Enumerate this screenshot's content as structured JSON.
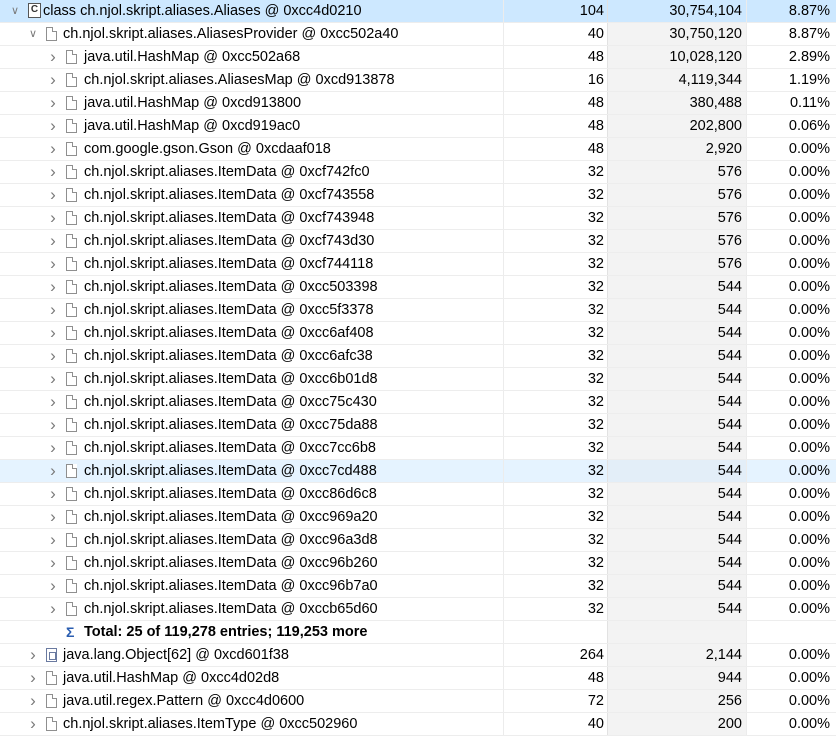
{
  "class_icon_letter": "C",
  "rows": [
    {
      "label": "class ch.njol.skript.aliases.Aliases @ 0xcc4d0210",
      "shallow": "104",
      "retained": "30,754,104",
      "pct": "8.87%",
      "depth": 0,
      "twisty": "open",
      "icon": "class",
      "state": "selected"
    },
    {
      "label": "ch.njol.skript.aliases.AliasesProvider @ 0xcc502a40",
      "shallow": "40",
      "retained": "30,750,120",
      "pct": "8.87%",
      "depth": 1,
      "twisty": "open",
      "icon": "object"
    },
    {
      "label": "java.util.HashMap @ 0xcc502a68",
      "shallow": "48",
      "retained": "10,028,120",
      "pct": "2.89%",
      "depth": 2,
      "twisty": "closed",
      "icon": "object"
    },
    {
      "label": "ch.njol.skript.aliases.AliasesMap @ 0xcd913878",
      "shallow": "16",
      "retained": "4,119,344",
      "pct": "1.19%",
      "depth": 2,
      "twisty": "closed",
      "icon": "object"
    },
    {
      "label": "java.util.HashMap @ 0xcd913800",
      "shallow": "48",
      "retained": "380,488",
      "pct": "0.11%",
      "depth": 2,
      "twisty": "closed",
      "icon": "object"
    },
    {
      "label": "java.util.HashMap @ 0xcd919ac0",
      "shallow": "48",
      "retained": "202,800",
      "pct": "0.06%",
      "depth": 2,
      "twisty": "closed",
      "icon": "object"
    },
    {
      "label": "com.google.gson.Gson @ 0xcdaaf018",
      "shallow": "48",
      "retained": "2,920",
      "pct": "0.00%",
      "depth": 2,
      "twisty": "closed",
      "icon": "object"
    },
    {
      "label": "ch.njol.skript.aliases.ItemData @ 0xcf742fc0",
      "shallow": "32",
      "retained": "576",
      "pct": "0.00%",
      "depth": 2,
      "twisty": "closed",
      "icon": "object"
    },
    {
      "label": "ch.njol.skript.aliases.ItemData @ 0xcf743558",
      "shallow": "32",
      "retained": "576",
      "pct": "0.00%",
      "depth": 2,
      "twisty": "closed",
      "icon": "object"
    },
    {
      "label": "ch.njol.skript.aliases.ItemData @ 0xcf743948",
      "shallow": "32",
      "retained": "576",
      "pct": "0.00%",
      "depth": 2,
      "twisty": "closed",
      "icon": "object"
    },
    {
      "label": "ch.njol.skript.aliases.ItemData @ 0xcf743d30",
      "shallow": "32",
      "retained": "576",
      "pct": "0.00%",
      "depth": 2,
      "twisty": "closed",
      "icon": "object"
    },
    {
      "label": "ch.njol.skript.aliases.ItemData @ 0xcf744118",
      "shallow": "32",
      "retained": "576",
      "pct": "0.00%",
      "depth": 2,
      "twisty": "closed",
      "icon": "object"
    },
    {
      "label": "ch.njol.skript.aliases.ItemData @ 0xcc503398",
      "shallow": "32",
      "retained": "544",
      "pct": "0.00%",
      "depth": 2,
      "twisty": "closed",
      "icon": "object"
    },
    {
      "label": "ch.njol.skript.aliases.ItemData @ 0xcc5f3378",
      "shallow": "32",
      "retained": "544",
      "pct": "0.00%",
      "depth": 2,
      "twisty": "closed",
      "icon": "object"
    },
    {
      "label": "ch.njol.skript.aliases.ItemData @ 0xcc6af408",
      "shallow": "32",
      "retained": "544",
      "pct": "0.00%",
      "depth": 2,
      "twisty": "closed",
      "icon": "object"
    },
    {
      "label": "ch.njol.skript.aliases.ItemData @ 0xcc6afc38",
      "shallow": "32",
      "retained": "544",
      "pct": "0.00%",
      "depth": 2,
      "twisty": "closed",
      "icon": "object"
    },
    {
      "label": "ch.njol.skript.aliases.ItemData @ 0xcc6b01d8",
      "shallow": "32",
      "retained": "544",
      "pct": "0.00%",
      "depth": 2,
      "twisty": "closed",
      "icon": "object"
    },
    {
      "label": "ch.njol.skript.aliases.ItemData @ 0xcc75c430",
      "shallow": "32",
      "retained": "544",
      "pct": "0.00%",
      "depth": 2,
      "twisty": "closed",
      "icon": "object"
    },
    {
      "label": "ch.njol.skript.aliases.ItemData @ 0xcc75da88",
      "shallow": "32",
      "retained": "544",
      "pct": "0.00%",
      "depth": 2,
      "twisty": "closed",
      "icon": "object"
    },
    {
      "label": "ch.njol.skript.aliases.ItemData @ 0xcc7cc6b8",
      "shallow": "32",
      "retained": "544",
      "pct": "0.00%",
      "depth": 2,
      "twisty": "closed",
      "icon": "object"
    },
    {
      "label": "ch.njol.skript.aliases.ItemData @ 0xcc7cd488",
      "shallow": "32",
      "retained": "544",
      "pct": "0.00%",
      "depth": 2,
      "twisty": "closed",
      "icon": "object",
      "state": "hover"
    },
    {
      "label": "ch.njol.skript.aliases.ItemData @ 0xcc86d6c8",
      "shallow": "32",
      "retained": "544",
      "pct": "0.00%",
      "depth": 2,
      "twisty": "closed",
      "icon": "object"
    },
    {
      "label": "ch.njol.skript.aliases.ItemData @ 0xcc969a20",
      "shallow": "32",
      "retained": "544",
      "pct": "0.00%",
      "depth": 2,
      "twisty": "closed",
      "icon": "object"
    },
    {
      "label": "ch.njol.skript.aliases.ItemData @ 0xcc96a3d8",
      "shallow": "32",
      "retained": "544",
      "pct": "0.00%",
      "depth": 2,
      "twisty": "closed",
      "icon": "object"
    },
    {
      "label": "ch.njol.skript.aliases.ItemData @ 0xcc96b260",
      "shallow": "32",
      "retained": "544",
      "pct": "0.00%",
      "depth": 2,
      "twisty": "closed",
      "icon": "object"
    },
    {
      "label": "ch.njol.skript.aliases.ItemData @ 0xcc96b7a0",
      "shallow": "32",
      "retained": "544",
      "pct": "0.00%",
      "depth": 2,
      "twisty": "closed",
      "icon": "object"
    },
    {
      "label": "ch.njol.skript.aliases.ItemData @ 0xccb65d60",
      "shallow": "32",
      "retained": "544",
      "pct": "0.00%",
      "depth": 2,
      "twisty": "closed",
      "icon": "object"
    },
    {
      "label": "Total: 25 of 119,278 entries; 119,253 more",
      "shallow": "",
      "retained": "",
      "pct": "",
      "depth": 2,
      "twisty": "none",
      "icon": "sum",
      "state": "total"
    },
    {
      "label": "java.lang.Object[62] @ 0xcd601f38",
      "shallow": "264",
      "retained": "2,144",
      "pct": "0.00%",
      "depth": 1,
      "twisty": "closed",
      "icon": "array"
    },
    {
      "label": "java.util.HashMap @ 0xcc4d02d8",
      "shallow": "48",
      "retained": "944",
      "pct": "0.00%",
      "depth": 1,
      "twisty": "closed",
      "icon": "object"
    },
    {
      "label": "java.util.regex.Pattern @ 0xcc4d0600",
      "shallow": "72",
      "retained": "256",
      "pct": "0.00%",
      "depth": 1,
      "twisty": "closed",
      "icon": "object"
    },
    {
      "label": "ch.njol.skript.aliases.ItemType @ 0xcc502960",
      "shallow": "40",
      "retained": "200",
      "pct": "0.00%",
      "depth": 1,
      "twisty": "closed",
      "icon": "object"
    }
  ]
}
